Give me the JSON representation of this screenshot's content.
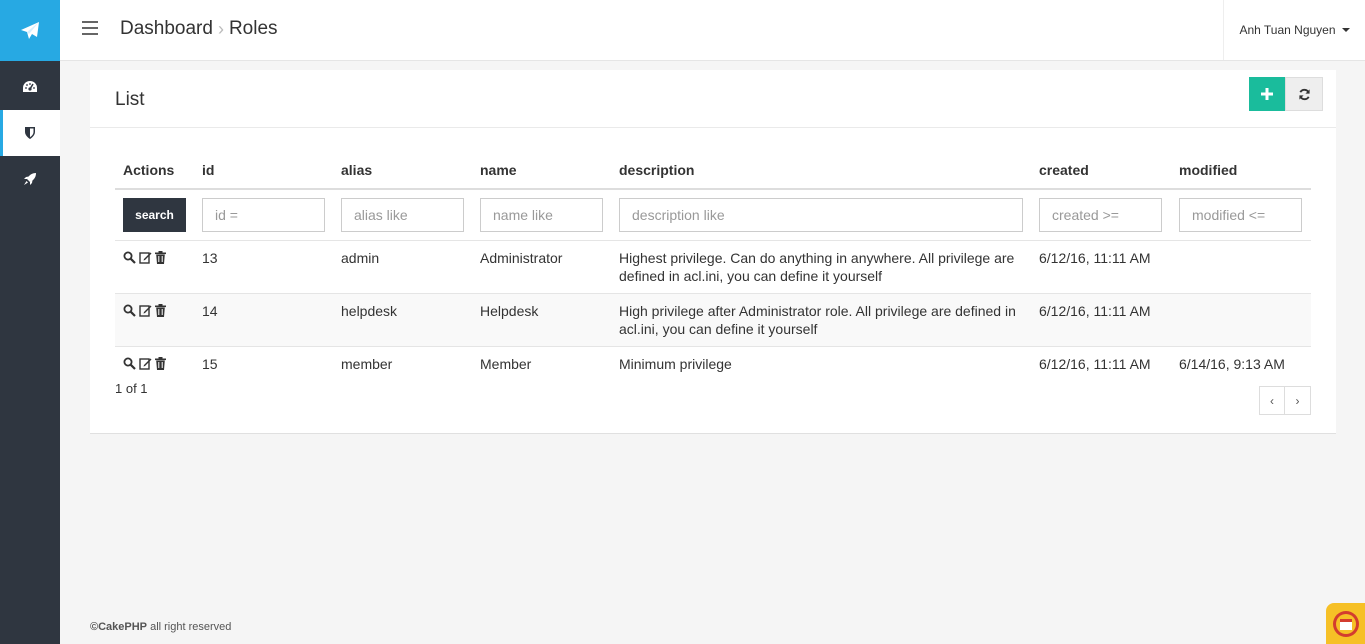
{
  "sidebar": {
    "brand_icon": "paper-plane-icon",
    "items": [
      {
        "name": "dashboard",
        "icon": "tachometer-icon",
        "active": false
      },
      {
        "name": "roles",
        "icon": "shield-icon",
        "active": true
      },
      {
        "name": "deploy",
        "icon": "rocket-icon",
        "active": false
      }
    ],
    "accent_color": "#27a9e3",
    "background_color": "#2f3640"
  },
  "header": {
    "breadcrumb": [
      "Dashboard",
      "Roles"
    ],
    "user_name": "Anh Tuan Nguyen"
  },
  "panel": {
    "title": "List",
    "add_button_color": "#1abc9c"
  },
  "table": {
    "columns": [
      "Actions",
      "id",
      "alias",
      "name",
      "description",
      "created",
      "modified"
    ],
    "search_label": "search",
    "filters": {
      "id": "id =",
      "alias": "alias like",
      "name": "name like",
      "description": "description like",
      "created": "created >=",
      "modified": "modified <="
    },
    "rows": [
      {
        "id": "13",
        "alias": "admin",
        "name": "Administrator",
        "description": "Highest privilege. Can do anything in anywhere. All privilege are defined in acl.ini, you can define it yourself",
        "created": "6/12/16, 11:11 AM",
        "modified": ""
      },
      {
        "id": "14",
        "alias": "helpdesk",
        "name": "Helpdesk",
        "description": "High privilege after Administrator role. All privilege are defined in acl.ini, you can define it yourself",
        "created": "6/12/16, 11:11 AM",
        "modified": ""
      },
      {
        "id": "15",
        "alias": "member",
        "name": "Member",
        "description": "Minimum privilege",
        "created": "6/12/16, 11:11 AM",
        "modified": "6/14/16, 9:13 AM"
      }
    ]
  },
  "pagination": {
    "text": "1 of 1",
    "prev": "‹",
    "next": "›"
  },
  "footer": {
    "brand": "©CakePHP",
    "text": " all right reserved"
  }
}
